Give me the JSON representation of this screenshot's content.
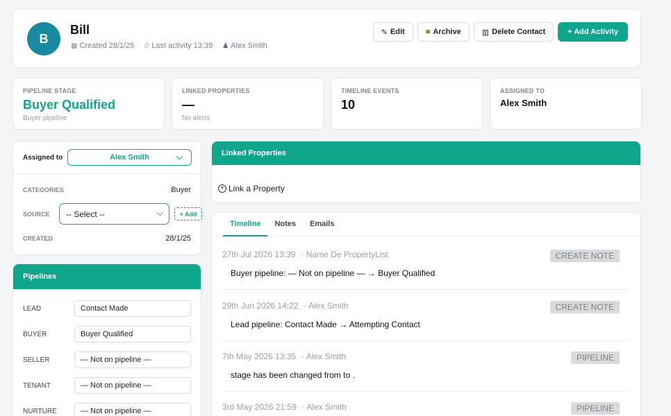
{
  "header": {
    "avatar_letter": "B",
    "name": "Bill",
    "created": "Created 28/1/25",
    "last_activity": "Last activity 13:39",
    "owner": "Alex Smith",
    "buttons": {
      "edit": "Edit",
      "archive": "Archive",
      "delete": "Delete Contact",
      "add_activity": "+ Add Activity"
    }
  },
  "stats": [
    {
      "label": "PIPELINE STAGE",
      "value": "Buyer Qualified",
      "sub": "Buyer pipeline"
    },
    {
      "label": "LINKED PROPERTIES",
      "value": "—",
      "sub": "No alerts"
    },
    {
      "label": "TIMELINE EVENTS",
      "value": "10",
      "sub": ""
    },
    {
      "label": "ASSIGNED TO",
      "value": "Alex Smith",
      "sub": ""
    }
  ],
  "details": {
    "assigned_label": "Assigned to",
    "assigned_value": "Alex Smith",
    "categories_label": "CATEGORIES",
    "categories_value": "Buyer",
    "source_label": "SOURCE",
    "source_value": "-- Select --",
    "add_label": "+ Add",
    "created_label": "CREATED",
    "created_value": "28/1/25"
  },
  "pipelines": {
    "title": "Pipelines",
    "rows": [
      {
        "label": "LEAD",
        "value": "Contact Made"
      },
      {
        "label": "BUYER",
        "value": "Buyer Qualified"
      },
      {
        "label": "SELLER",
        "value": "— Not on pipeline —"
      },
      {
        "label": "TENANT",
        "value": "— Not on pipeline —"
      },
      {
        "label": "NURTURE",
        "value": "— Not on pipeline —"
      }
    ]
  },
  "linked": {
    "title": "Linked Properties",
    "link_label": "Link a Property"
  },
  "timeline": {
    "tabs": [
      "Timeline",
      "Notes",
      "Emails"
    ],
    "events": [
      {
        "date": "27th Jul 2026 13:39",
        "who": "· Name De PropertyList",
        "tag": "CREATE NOTE",
        "body": "Buyer pipeline: — Not on pipeline — → Buyer Qualified"
      },
      {
        "date": "29th Jun 2026 14:22",
        "who": "· Alex Smith",
        "tag": "CREATE NOTE",
        "body": "Lead pipeline: Contact Made → Attempting Contact"
      },
      {
        "date": "7th May 2026 13:35",
        "who": "· Alex Smith",
        "tag": "PIPELINE",
        "body": "stage has been changed from to ."
      },
      {
        "date": "3rd May 2026 21:59",
        "who": "· Alex Smith",
        "tag": "PIPELINE",
        "body": ""
      }
    ]
  },
  "colors": {
    "accent": "#10a68b",
    "avatar": "#1789a1"
  }
}
